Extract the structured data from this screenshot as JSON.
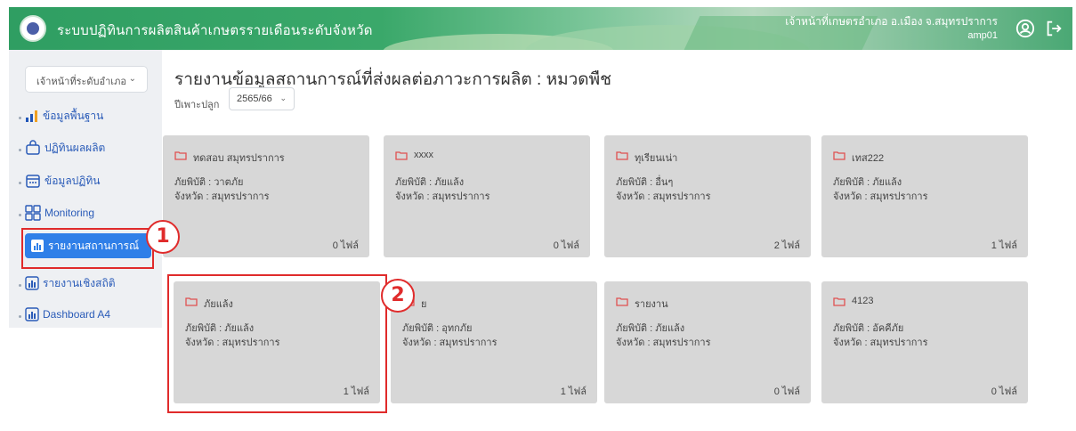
{
  "header": {
    "app_title": "ระบบปฏิทินการผลิตสินค้าเกษตรรายเดือนระดับจังหวัด",
    "user_name": "เจ้าหน้าที่เกษตรอำเภอ อ.เมือง จ.สมุทรปราการ",
    "user_id": "amp01",
    "icons": [
      "user-circle-icon",
      "logout-icon"
    ]
  },
  "sidebar": {
    "role_select": "เจ้าหน้าที่ระดับอำเภอ",
    "items": [
      {
        "label": "ข้อมูลพื้นฐาน",
        "icon": "bar-chart-icon"
      },
      {
        "label": "ปฏิทินผลผลิต",
        "icon": "bag-icon"
      },
      {
        "label": "ข้อมูลปฏิทิน",
        "icon": "calendar-icon"
      },
      {
        "label": "Monitoring",
        "icon": "grid-icon"
      },
      {
        "label": "รายงานสถานการณ์",
        "icon": "report-icon",
        "active": true
      },
      {
        "label": "รายงานเชิงสถิติ",
        "icon": "report-icon"
      },
      {
        "label": "Dashboard A4",
        "icon": "report-icon"
      }
    ]
  },
  "main": {
    "title": "รายงานข้อมูลสถานการณ์ที่ส่งผลต่อภาวะการผลิต : หมวดพืช",
    "season_label": "ปีเพาะปลูก",
    "season_value": "2565/66",
    "cards": [
      {
        "name": "ทดสอบ สมุทรปราการ",
        "hazard": "ภัยพิบัติ : วาตภัย",
        "province": "จังหวัด : สมุทรปราการ",
        "files": "0 ไฟล์"
      },
      {
        "name": "xxxx",
        "hazard": "ภัยพิบัติ : ภัยแล้ง",
        "province": "จังหวัด : สมุทรปราการ",
        "files": "0 ไฟล์"
      },
      {
        "name": "ทุเรียนเน่า",
        "hazard": "ภัยพิบัติ : อื่นๆ",
        "province": "จังหวัด : สมุทรปราการ",
        "files": "2 ไฟล์"
      },
      {
        "name": "เทส222",
        "hazard": "ภัยพิบัติ : ภัยแล้ง",
        "province": "จังหวัด : สมุทรปราการ",
        "files": "1 ไฟล์"
      },
      {
        "name": "ภัยแล้ง",
        "hazard": "ภัยพิบัติ : ภัยแล้ง",
        "province": "จังหวัด : สมุทรปราการ",
        "files": "1 ไฟล์"
      },
      {
        "name": "ย",
        "hazard": "ภัยพิบัติ : อุทกภัย",
        "province": "จังหวัด : สมุทรปราการ",
        "files": "1 ไฟล์"
      },
      {
        "name": "รายงาน",
        "hazard": "ภัยพิบัติ : ภัยแล้ง",
        "province": "จังหวัด : สมุทรปราการ",
        "files": "0 ไฟล์"
      },
      {
        "name": "4123",
        "hazard": "ภัยพิบัติ : อัคคีภัย",
        "province": "จังหวัด : สมุทรปราการ",
        "files": "0 ไฟล์"
      }
    ]
  },
  "annotations": {
    "step1": "1",
    "step2": "2"
  },
  "colors": {
    "header_green": "#2f9e62",
    "active_blue": "#2f7fe8",
    "card_gray": "#d7d7d7",
    "highlight_red": "#e02b2b",
    "folder_red": "#e05050"
  }
}
